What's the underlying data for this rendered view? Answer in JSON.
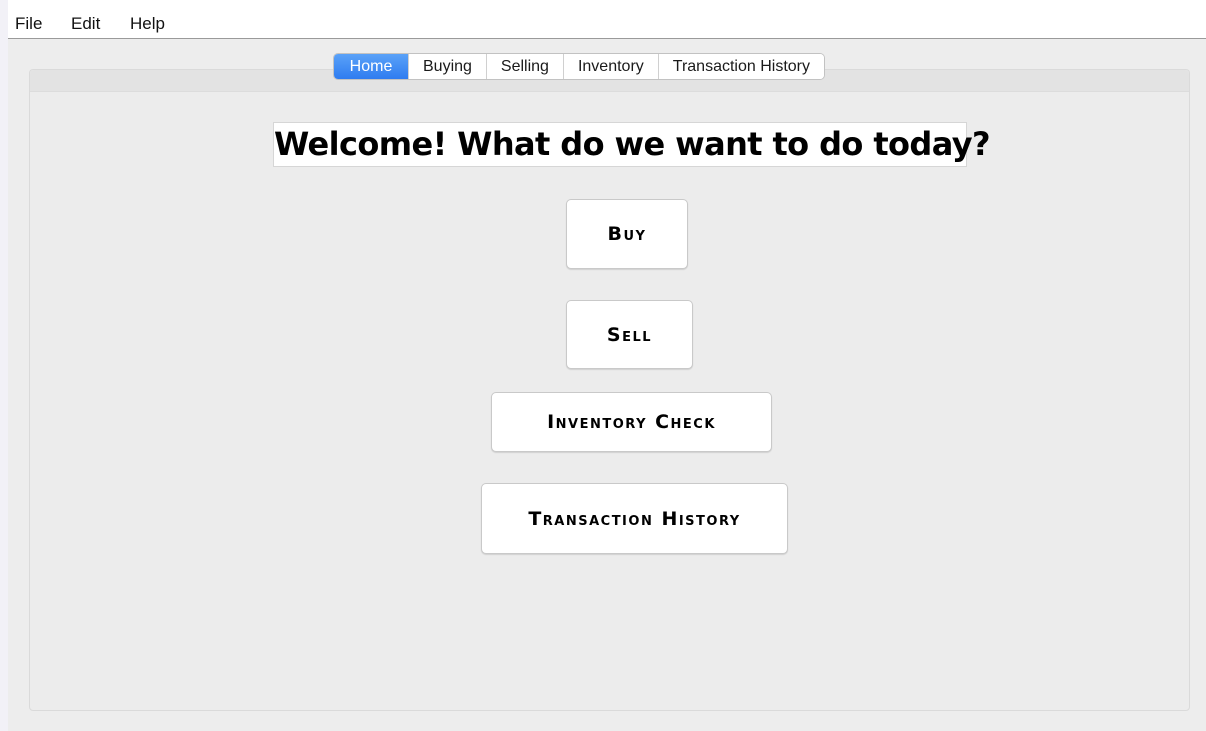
{
  "menubar": {
    "items": [
      "File",
      "Edit",
      "Help"
    ]
  },
  "tabs": [
    {
      "label": "Home",
      "active": true
    },
    {
      "label": "Buying",
      "active": false
    },
    {
      "label": "Selling",
      "active": false
    },
    {
      "label": "Inventory",
      "active": false
    },
    {
      "label": "Transaction History",
      "active": false
    }
  ],
  "home": {
    "heading": "Welcome! What do we want to do today?",
    "buttons": {
      "buy": "Buy",
      "sell": "Sell",
      "inventory_check": "Inventory Check",
      "transaction_history": "Transaction History"
    }
  },
  "colors": {
    "active_tab": "#2f7cf0",
    "background": "#ededed"
  }
}
